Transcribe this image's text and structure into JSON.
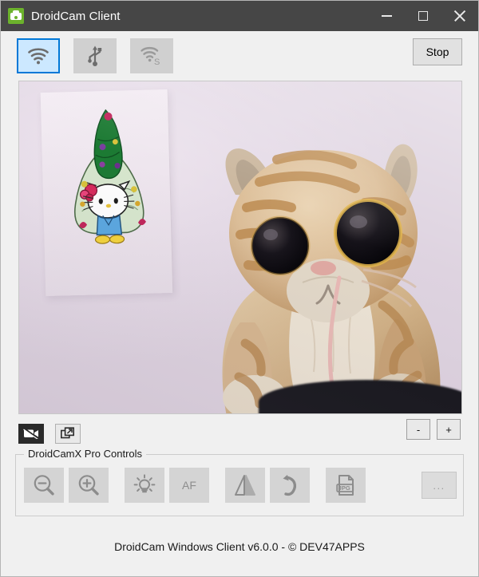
{
  "window": {
    "title": "DroidCam Client",
    "app_icon": "droidcam-app-icon",
    "minimize_label": "Minimize",
    "maximize_label": "Maximize",
    "close_label": "Close"
  },
  "toolbar": {
    "connection_modes": [
      {
        "id": "wifi",
        "icon": "wifi-icon",
        "label": "WiFi / LAN",
        "selected": true
      },
      {
        "id": "usb",
        "icon": "usb-icon",
        "label": "USB",
        "selected": false
      },
      {
        "id": "wifi-server",
        "icon": "wifi-server-icon",
        "label": "WiFi Server",
        "selected": false
      }
    ],
    "stop_label": "Stop"
  },
  "video": {
    "alt": "Live camera preview: plush tabby cat in front of a pale wall with a Hello Kitty Christmas tree drawing taped to it",
    "streaming": true
  },
  "video_controls": {
    "mute_video_icon": "video-off-icon",
    "mute_video_label": "Video off",
    "popout_icon": "popout-window-icon",
    "popout_label": "Pop out preview",
    "zoom_out_label": "-",
    "zoom_in_label": "+"
  },
  "pro_controls": {
    "legend": "DroidCamX Pro Controls",
    "buttons": [
      {
        "id": "zoom-out",
        "icon": "magnifier-minus-icon",
        "label": "Zoom out",
        "text": ""
      },
      {
        "id": "zoom-in",
        "icon": "magnifier-plus-icon",
        "label": "Zoom in",
        "text": ""
      },
      {
        "id": "flashlight",
        "icon": "lightbulb-icon",
        "label": "Flashlight",
        "text": ""
      },
      {
        "id": "autofocus",
        "icon": "af-text-icon",
        "label": "Autofocus",
        "text": "AF"
      },
      {
        "id": "mirror",
        "icon": "mirror-flip-icon",
        "label": "Mirror",
        "text": ""
      },
      {
        "id": "rotate",
        "icon": "rotate-arrow-icon",
        "label": "Rotate",
        "text": ""
      },
      {
        "id": "save-jpg",
        "icon": "jpg-file-icon",
        "label": "Save JPG",
        "text": ""
      }
    ],
    "more_label": "...",
    "more_icon": "ellipsis-icon"
  },
  "footer": {
    "text": "DroidCam Windows Client v6.0.0 - © DEV47APPS"
  },
  "colors": {
    "titlebar": "#464646",
    "window_bg": "#f0f0f0",
    "accent_selected": "#0078d7",
    "accent_selected_fill": "#cce8ff",
    "button_face": "#d0d0d0",
    "pro_button_face": "#d4d4d4",
    "app_icon_green": "#6cb22c"
  }
}
